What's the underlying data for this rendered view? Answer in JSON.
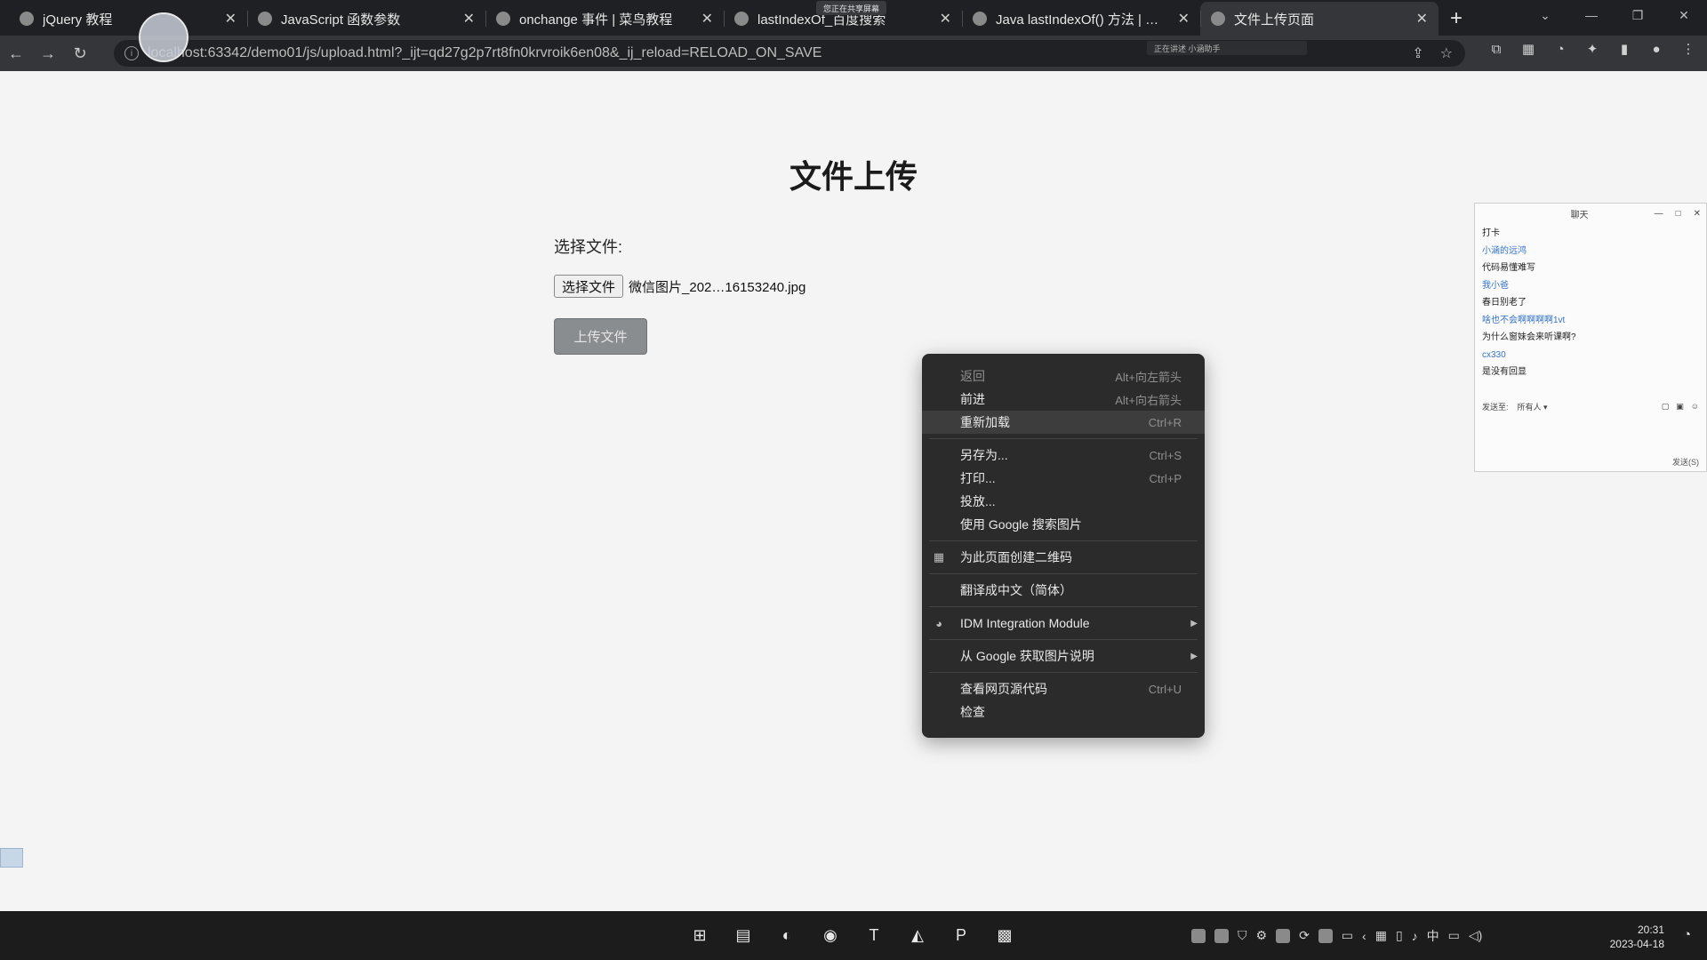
{
  "browser": {
    "tabs": [
      {
        "title": "jQuery 教程",
        "active": false
      },
      {
        "title": "JavaScript 函数参数",
        "active": false
      },
      {
        "title": "onchange 事件 | 菜鸟教程",
        "active": false
      },
      {
        "title": "lastIndexOf_百度搜索",
        "active": false
      },
      {
        "title": "Java lastIndexOf() 方法 | 菜鸟教",
        "active": false
      },
      {
        "title": "文件上传页面",
        "active": true
      }
    ],
    "new_tab_symbol": "+",
    "share_notice": "您正在共享屏幕",
    "url": "localhost:63342/demo01/js/upload.html?_ijt=qd27g2p7rt8fn0krvroik6en08&_ij_reload=RELOAD_ON_SAVE",
    "status_chip": "正在讲述 小涵助手"
  },
  "page": {
    "title": "文件上传",
    "choose_label": "选择文件:",
    "file_button": "选择文件",
    "file_name": "微信图片_202…16153240.jpg",
    "upload_button": "上传文件"
  },
  "context_menu": {
    "items": [
      {
        "label": "返回",
        "shortcut": "Alt+向左箭头",
        "dim": true
      },
      {
        "label": "前进",
        "shortcut": "Alt+向右箭头",
        "dim": false
      },
      {
        "label": "重新加载",
        "shortcut": "Ctrl+R",
        "dim": false,
        "hover": true
      },
      {
        "sep": true
      },
      {
        "label": "另存为...",
        "shortcut": "Ctrl+S",
        "dim": false
      },
      {
        "label": "打印...",
        "shortcut": "Ctrl+P",
        "dim": false
      },
      {
        "label": "投放...",
        "shortcut": "",
        "dim": false
      },
      {
        "label": "使用 Google 搜索图片",
        "shortcut": "",
        "dim": false
      },
      {
        "sep": true
      },
      {
        "label": "为此页面创建二维码",
        "shortcut": "",
        "icon": "qr-code-icon"
      },
      {
        "sep": true
      },
      {
        "label": "翻译成中文（简体）",
        "shortcut": ""
      },
      {
        "sep": true
      },
      {
        "label": "IDM Integration Module",
        "shortcut": "",
        "icon": "idm-icon",
        "submenu": true
      },
      {
        "sep": true
      },
      {
        "label": "从 Google 获取图片说明",
        "shortcut": "",
        "submenu": true
      },
      {
        "sep": true
      },
      {
        "label": "查看网页源代码",
        "shortcut": "Ctrl+U"
      },
      {
        "label": "检查",
        "shortcut": ""
      }
    ]
  },
  "chat": {
    "title": "聊天",
    "messages": [
      {
        "text": "打卡",
        "user": false
      },
      {
        "text": "小涵的远鸿",
        "user": true
      },
      {
        "text": "代码易懂难写",
        "user": false
      },
      {
        "text": "我小爸",
        "user": true
      },
      {
        "text": "春日别老了",
        "user": false
      },
      {
        "text": "啥也不会啊啊啊啊1vt",
        "user": true
      },
      {
        "text": "为什么窗妹会来听课啊?",
        "user": false
      },
      {
        "text": "cx330",
        "user": true
      },
      {
        "text": "是没有回显",
        "user": false
      }
    ],
    "send_to_label": "发送至:",
    "send_to_value": "所有人 ▾",
    "send_button": "发送(S)"
  },
  "taskbar": {
    "tray_lang": "中",
    "time": "20:31",
    "date": "2023-04-18"
  },
  "colors": {
    "browser_bg": "#1f2023",
    "toolbar_bg": "#35363a",
    "page_bg": "#f4f4f4",
    "menu_bg": "#2b2b2b",
    "upload_button_bg": "#8a8d90",
    "chat_user_link": "#3473c6"
  }
}
